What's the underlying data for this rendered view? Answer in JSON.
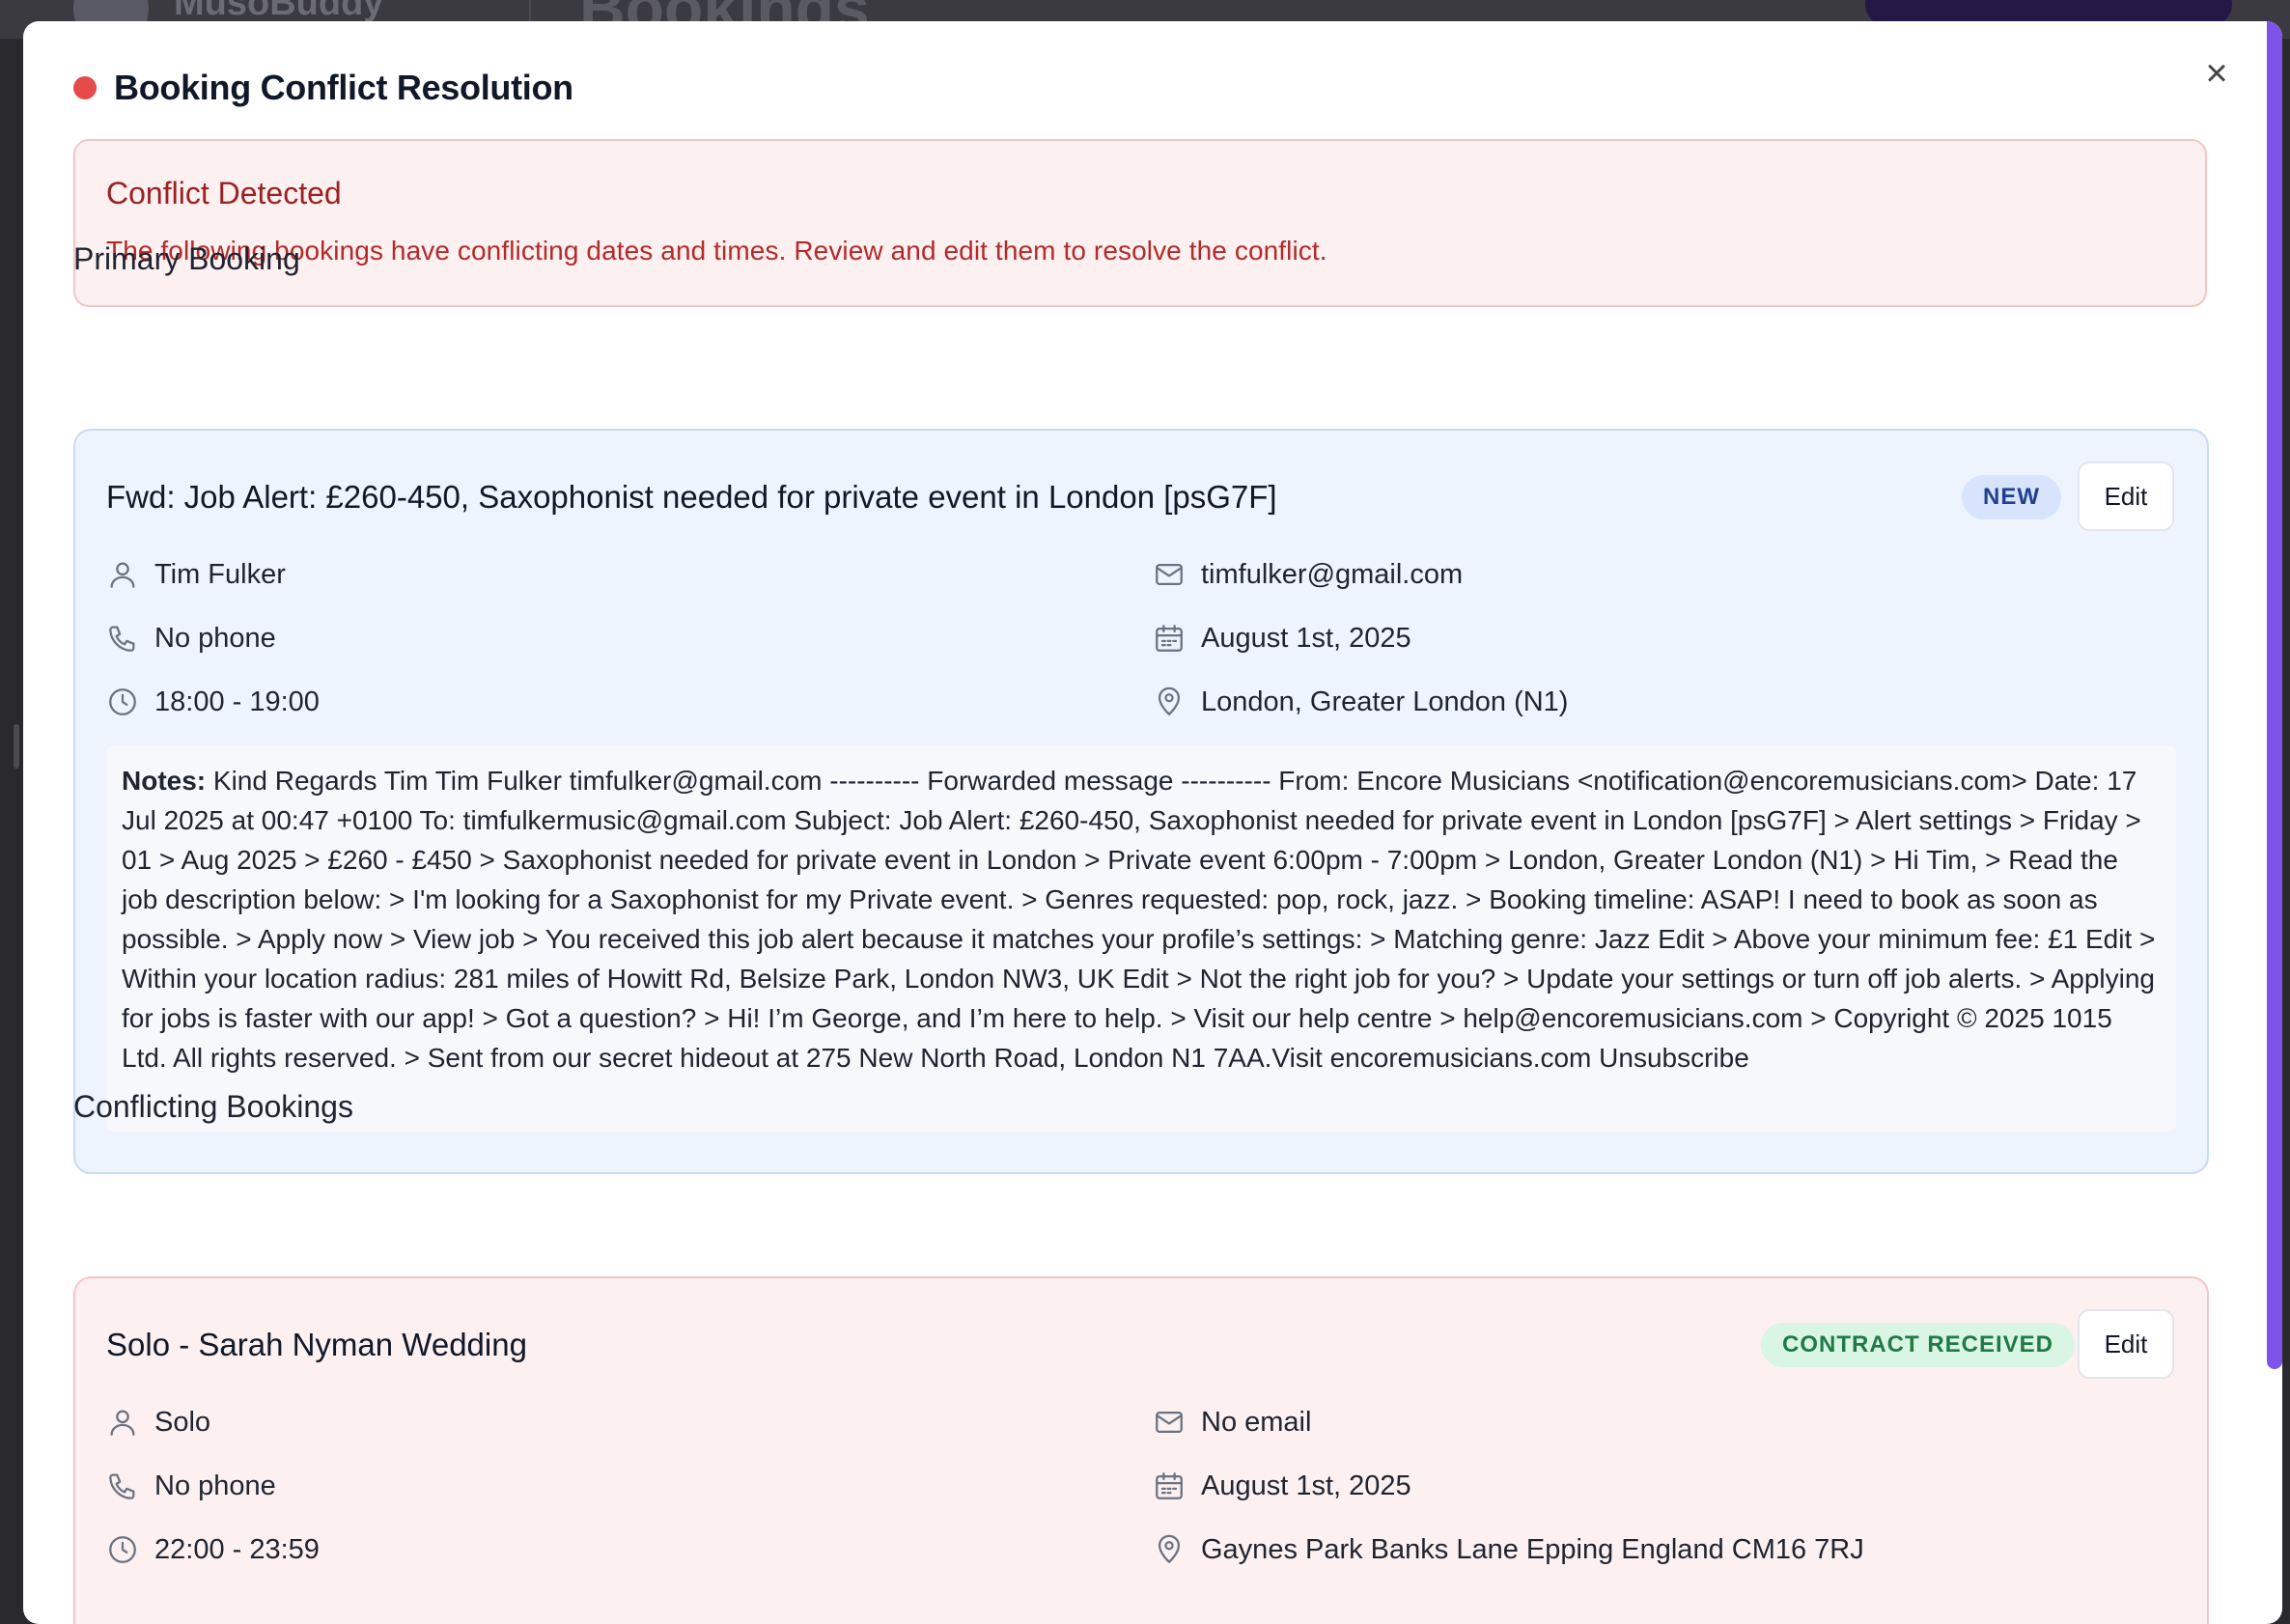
{
  "background": {
    "brand": "MusoBuddy",
    "page_title": "Bookings"
  },
  "modal": {
    "title": "Booking Conflict Resolution",
    "close_label": "×",
    "alert": {
      "title": "Conflict Detected",
      "text": "The following bookings have conflicting dates and times. Review and edit them to resolve the conflict."
    },
    "primary_heading": "Primary Booking",
    "conflicting_heading": "Conflicting Bookings",
    "edit_label": "Edit",
    "notes_label": "Notes:"
  },
  "primary_booking": {
    "title": "Fwd: Job Alert: £260-450, Saxophonist needed for private event in London [psG7F]",
    "status": "NEW",
    "client": "Tim Fulker",
    "email": "timfulker@gmail.com",
    "phone": "No phone",
    "date": "August 1st, 2025",
    "time": "18:00 - 19:00",
    "location": "London, Greater London (N1)",
    "notes": "Kind Regards Tim Tim Fulker timfulker@gmail.com ---------- Forwarded message ---------- From: Encore Musicians <notification@encoremusicians.com> Date: 17 Jul 2025 at 00:47 +0100 To: timfulkermusic@gmail.com Subject: Job Alert: £260-450, Saxophonist needed for private event in London [psG7F] > Alert settings > Friday > 01 > Aug 2025 > £260 - £450 > Saxophonist needed for private event in London > Private event 6:00pm - 7:00pm > London, Greater London (N1) > Hi Tim, > Read the job description below: > I'm looking for a Saxophonist for my Private event. > Genres requested: pop, rock, jazz. > Booking timeline: ASAP! I need to book as soon as possible. > Apply now > View job > You received this job alert because it matches your profile’s settings: > Matching genre: Jazz Edit > Above your minimum fee: £1 Edit > Within your location radius: 281 miles of Howitt Rd, Belsize Park, London NW3, UK Edit > Not the right job for you? > Update your settings or turn off job alerts. > Applying for jobs is faster with our app! > Got a question? > Hi! I’m George, and I’m here to help. > Visit our help centre > help@encoremusicians.com > Copyright © 2025 1015 Ltd. All rights reserved. > Sent from our secret hideout at 275 New North Road, London N1 7AA.Visit encoremusicians.com Unsubscribe"
  },
  "conflicting_booking": {
    "title": "Solo - Sarah Nyman Wedding",
    "status": "CONTRACT RECEIVED",
    "client": "Solo",
    "email": "No email",
    "phone": "No phone",
    "date": "August 1st, 2025",
    "time": "22:00 - 23:59",
    "location": "Gaynes Park Banks Lane Epping England CM16 7RJ"
  },
  "colors": {
    "accent_scrollbar": "#7c55e8",
    "conflict_red": "#e54b4b",
    "new_badge": "#233f8e",
    "contract_badge": "#1f7a47"
  }
}
